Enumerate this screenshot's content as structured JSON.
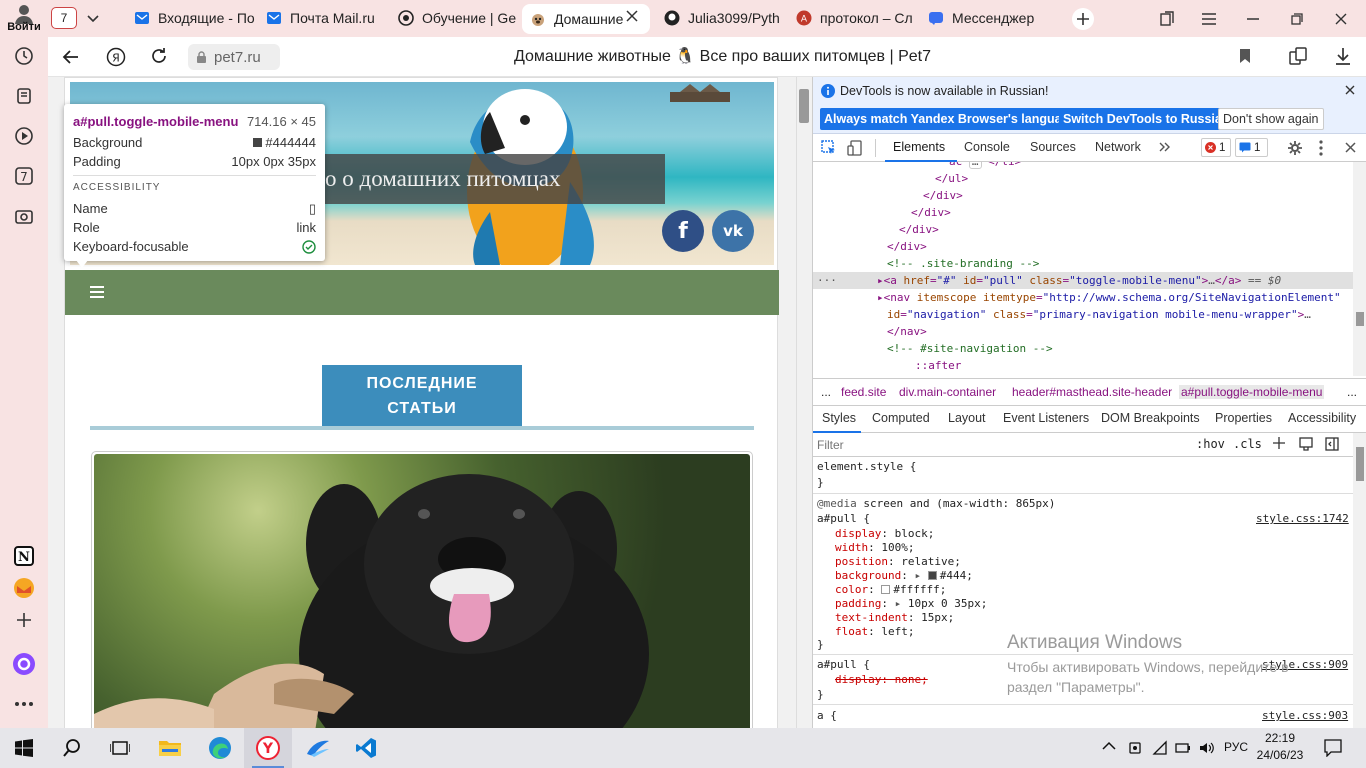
{
  "browser": {
    "login_label": "Войти",
    "tab_count": "7",
    "tabs": [
      {
        "title": "Входящие - По",
        "icon": "outlook-icon"
      },
      {
        "title": "Почта Mail.ru",
        "icon": "outlook-icon"
      },
      {
        "title": "Обучение | Ge",
        "icon": "geekbrains-icon"
      },
      {
        "title": "Домашние",
        "icon": "pug-icon",
        "active": true
      },
      {
        "title": "Julia3099/Pyth",
        "icon": "github-icon"
      },
      {
        "title": "протокол – Сл",
        "icon": "translator-icon"
      },
      {
        "title": "Мессенджер",
        "icon": "messenger-icon"
      }
    ],
    "url": "pet7.ru",
    "page_title": "Домашние животные 🐧 Все про ваших питомцев | Pet7"
  },
  "site": {
    "hero_text": "о о домашних питомцах",
    "social": [
      "f",
      "vk"
    ],
    "section_heading": "ПОСЛЕДНИЕ СТАТЬИ",
    "colors": {
      "nav": "#6a8a5c",
      "heading": "#3c8dbc",
      "rule": "#a9ccd8"
    }
  },
  "tooltip": {
    "selector": "a#pull.toggle-mobile-menu",
    "size": "714.16 × 45",
    "background_label": "Background",
    "background_value": "#444444",
    "padding_label": "Padding",
    "padding_value": "10px 0px 35px",
    "accessibility_label": "ACCESSIBILITY",
    "name_label": "Name",
    "name_value": "▯",
    "role_label": "Role",
    "role_value": "link",
    "focus_label": "Keyboard-focusable"
  },
  "devtools": {
    "info_text": "DevTools is now available in Russian!",
    "btn_match": "Always match Yandex Browser's language",
    "btn_switch": "Switch DevTools to Russian",
    "btn_dont": "Don't show again",
    "tabs": [
      "Elements",
      "Console",
      "Sources",
      "Network"
    ],
    "error_count": "1",
    "message_count": "1",
    "dom_lines": {
      "l0": "ac",
      "l1": "</ul>",
      "l2": "</div>",
      "l3": "</div>",
      "l4": "</div>",
      "l5": "</div>",
      "l6": "<!-- .site-branding -->",
      "l7_tag": "<a ",
      "l7_attr1": "href",
      "l7_val1": "\"#\"",
      "l7_attr2": "id",
      "l7_val2": "\"pull\"",
      "l7_attr3": "class",
      "l7_val3": "\"toggle-mobile-menu\"",
      "l7_end": "</a>",
      "l7_eq": "== $0",
      "l8_tag": "<nav ",
      "l8_attr1": "itemscope",
      "l8_attr2": "itemtype",
      "l8_val2": "\"http://www.schema.org/SiteNavigationElement\"",
      "l9_attr1": "id",
      "l9_val1": "\"navigation\"",
      "l9_attr2": "class",
      "l9_val2": "\"primary-navigation mobile-menu-wrapper\"",
      "l10": "</nav>",
      "l11": "<!-- #site-navigation -->",
      "l12": "::after"
    },
    "breadcrumbs": [
      "...",
      "feed.site",
      "div.main-container",
      "header#masthead.site-header",
      "a#pull.toggle-mobile-menu",
      "..."
    ],
    "subtabs": [
      "Styles",
      "Computed",
      "Layout",
      "Event Listeners",
      "DOM Breakpoints",
      "Properties",
      "Accessibility"
    ],
    "filter_placeholder": "Filter",
    "hov": ":hov",
    "cls": ".cls",
    "styles": {
      "element_style": "element.style {",
      "close": "}",
      "media_kw": "@media",
      "media_rest": " screen and (max-width: 865px)",
      "rule1_sel": "a#pull {",
      "rule1_src": "style.css:1742",
      "props": [
        {
          "name": "display",
          "value": "block;"
        },
        {
          "name": "width",
          "value": "100%;"
        },
        {
          "name": "position",
          "value": "relative;"
        },
        {
          "name": "background",
          "value": "#444;"
        },
        {
          "name": "color",
          "value": "#ffffff;"
        },
        {
          "name": "padding",
          "value": "10px 0 35px;"
        },
        {
          "name": "text-indent",
          "value": "15px;"
        },
        {
          "name": "float",
          "value": "left;"
        }
      ],
      "rule2_sel": "a#pull {",
      "rule2_src": "style.css:909",
      "rule2_prop": "display: none;",
      "rule3_sel": "a {",
      "rule3_src": "style.css:903"
    }
  },
  "watermark": {
    "title": "Активация Windows",
    "line1": "Чтобы активировать Windows, перейдите в",
    "line2": "раздел \"Параметры\"."
  },
  "taskbar": {
    "lang": "РУС",
    "time": "22:19",
    "date": "24/06/23"
  }
}
